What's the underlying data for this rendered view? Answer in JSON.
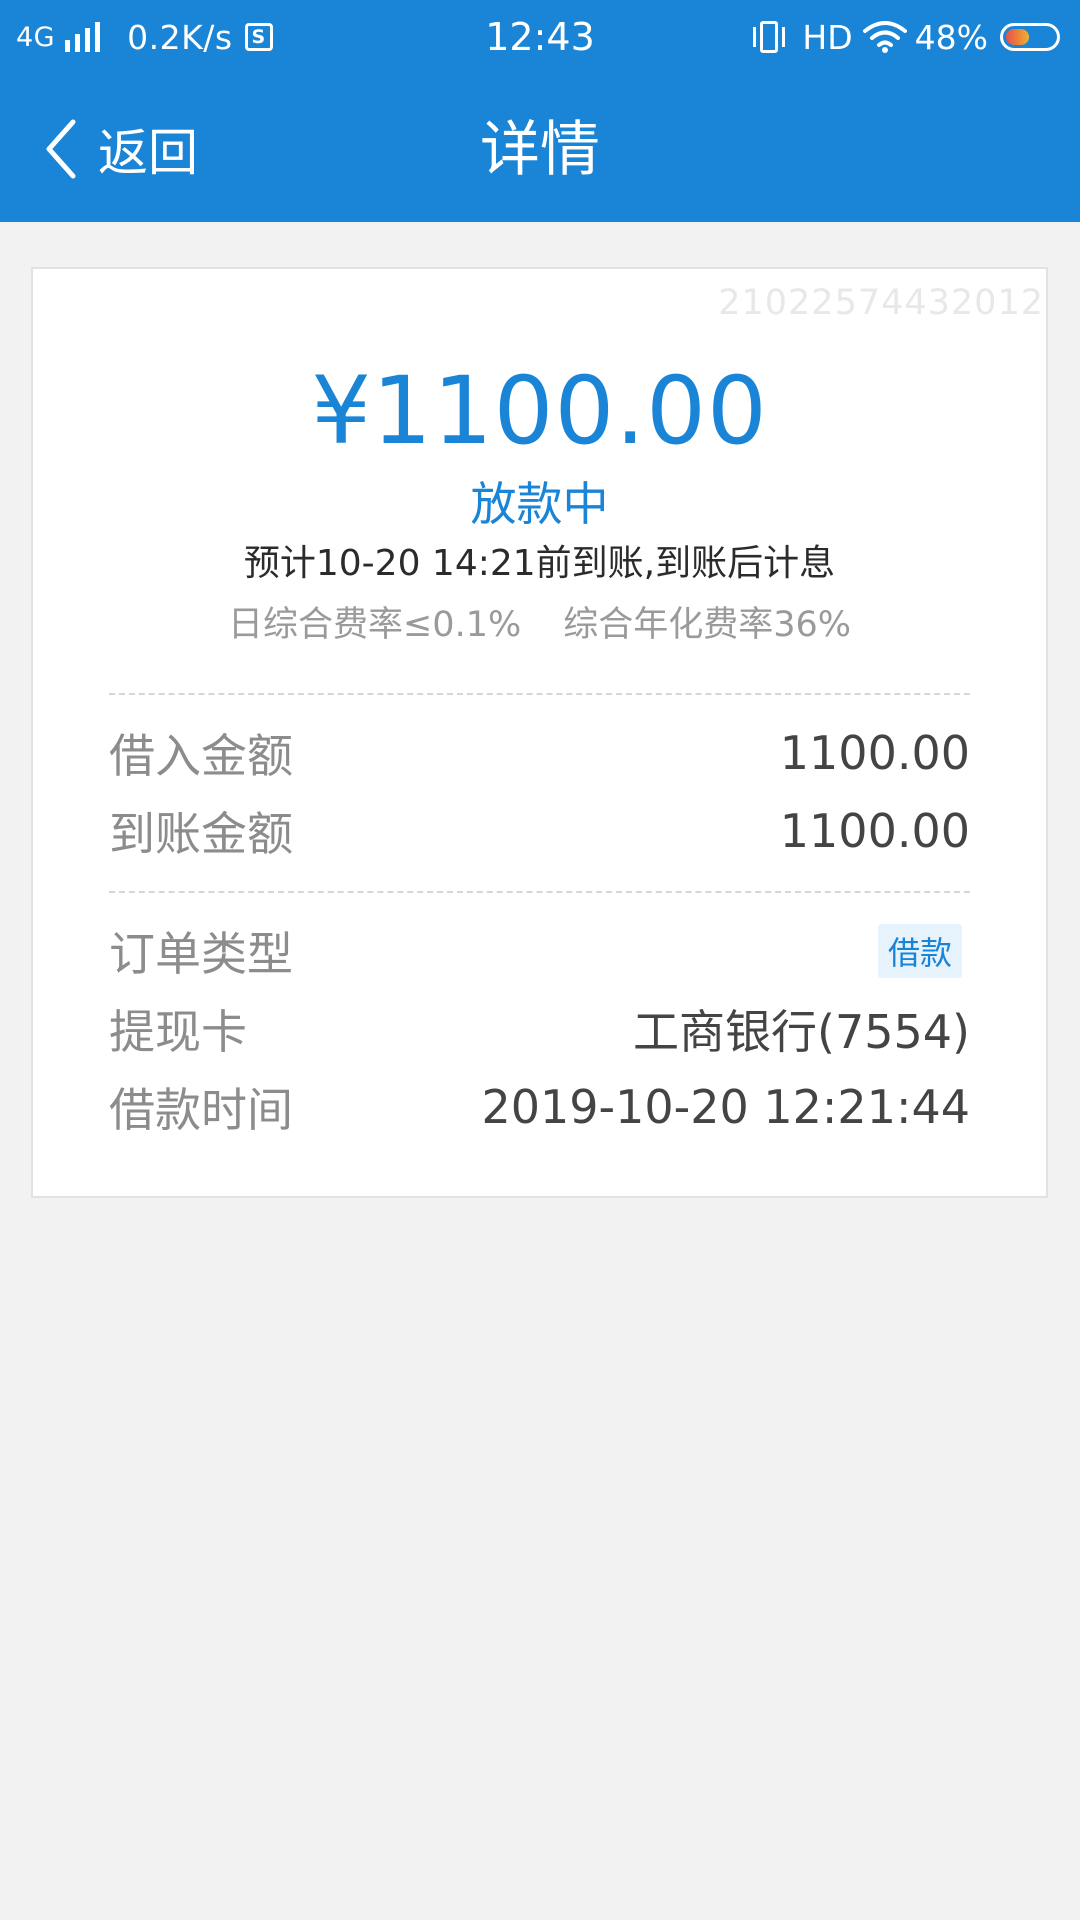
{
  "status_bar": {
    "network": "4G",
    "speed": "0.2K/s",
    "s_badge": "S",
    "time": "12:43",
    "hd": "HD",
    "battery_percent": "48%",
    "battery_level": 0.48,
    "icons": [
      "signal-icon",
      "s-app-icon",
      "vibrate-icon",
      "wifi-icon",
      "battery-icon"
    ]
  },
  "nav": {
    "back_label": "返回",
    "title": "详情"
  },
  "card": {
    "order_number": "21022574432012",
    "amount": "¥1100.00",
    "status": "放款中",
    "arrival_note": "预计10-20 14:21前到账,到账后计息",
    "daily_rate": "日综合费率≤0.1%",
    "annual_rate": "综合年化费率36%",
    "borrowed_label": "借入金额",
    "borrowed_value": "1100.00",
    "received_label": "到账金额",
    "received_value": "1100.00",
    "order_type_label": "订单类型",
    "order_type_value": "借款",
    "card_label": "提现卡",
    "card_value": "工商银行(7554)",
    "time_label": "借款时间",
    "time_value": "2019-10-20 12:21:44"
  },
  "colors": {
    "primary": "#1a85d6",
    "background": "#f2f2f2",
    "card": "#ffffff"
  }
}
